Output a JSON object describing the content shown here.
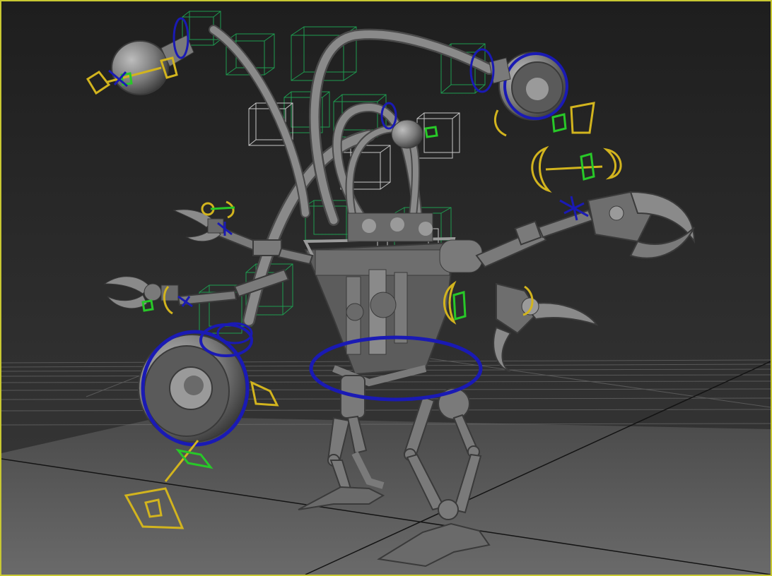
{
  "viewport": {
    "active_border_color": "#c8c832",
    "background_top": "#1e1e1e",
    "background_bottom": "#3a3a3a",
    "ground_color": "#5a5a5a",
    "grid_color": "#7a7a7a",
    "grid_axis_color": "#141414"
  },
  "rig_colors": {
    "model": "#8a8a8a",
    "model_dark": "#4a4a4a",
    "ik_controller": "#1a1ab4",
    "fk_controller": "#d2b41e",
    "helper_box": "#1e9c50",
    "helper_box_white": "#c8c8c8",
    "point_helper": "#28c828"
  },
  "scene_objects": [
    "robot-body",
    "left-eye-pod",
    "right-eye-pod",
    "upper-left-eye-pod",
    "center-eye-pod",
    "left-claw-upper",
    "left-claw-lower",
    "right-claw-upper",
    "right-claw-lower",
    "left-leg",
    "right-leg",
    "hip-ring-controller"
  ]
}
